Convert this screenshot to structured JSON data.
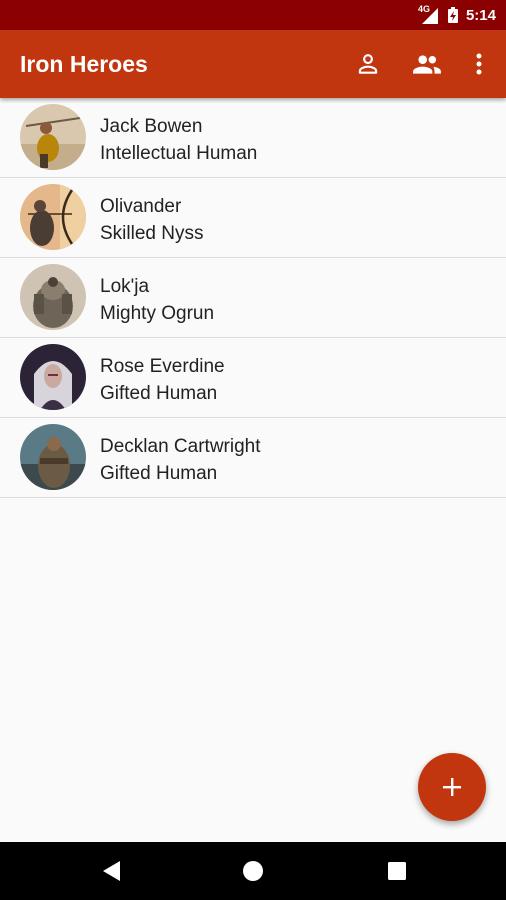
{
  "status_bar": {
    "network_label": "4G",
    "time": "5:14",
    "background": "#8b0000"
  },
  "app_bar": {
    "title": "Iron Heroes",
    "background": "#c1360e",
    "actions": [
      "person-icon",
      "group-icon",
      "more-vert-icon"
    ]
  },
  "heroes": [
    {
      "name": "Jack Bowen",
      "subtitle": "Intellectual Human"
    },
    {
      "name": "Olivander",
      "subtitle": "Skilled Nyss"
    },
    {
      "name": "Lok'ja",
      "subtitle": "Mighty Ogrun"
    },
    {
      "name": "Rose Everdine",
      "subtitle": "Gifted Human"
    },
    {
      "name": "Decklan Cartwright",
      "subtitle": "Gifted Human"
    }
  ],
  "fab": {
    "icon": "add-icon",
    "color": "#c1360e"
  },
  "nav_bar": {
    "buttons": [
      "back-icon",
      "home-icon",
      "recents-icon"
    ]
  }
}
